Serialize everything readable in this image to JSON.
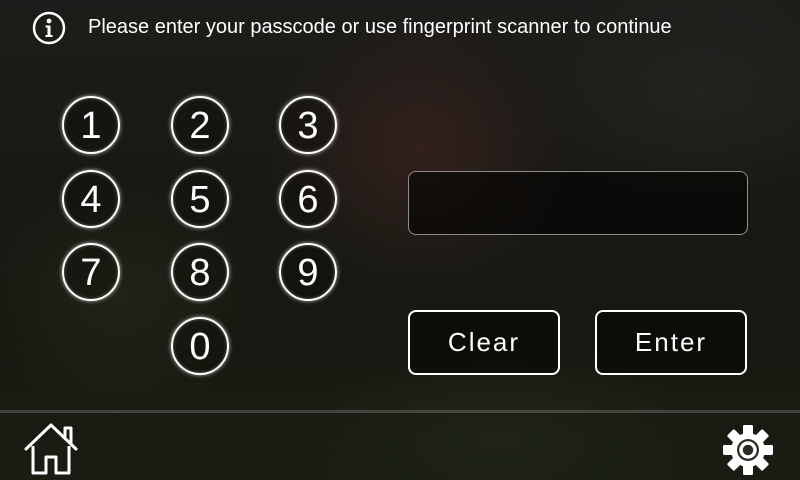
{
  "header": {
    "message": "Please enter your passcode or use fingerprint scanner to continue",
    "info_icon": "info-icon"
  },
  "keypad": {
    "keys": [
      "1",
      "2",
      "3",
      "4",
      "5",
      "6",
      "7",
      "8",
      "9",
      "0"
    ]
  },
  "passcode": {
    "value": "",
    "placeholder": ""
  },
  "actions": {
    "clear_label": "Clear",
    "enter_label": "Enter"
  },
  "footer": {
    "home_icon": "home-icon",
    "settings_icon": "gear-icon"
  },
  "colors": {
    "foreground": "#ffffff",
    "field_border": "#8e8e8e"
  }
}
